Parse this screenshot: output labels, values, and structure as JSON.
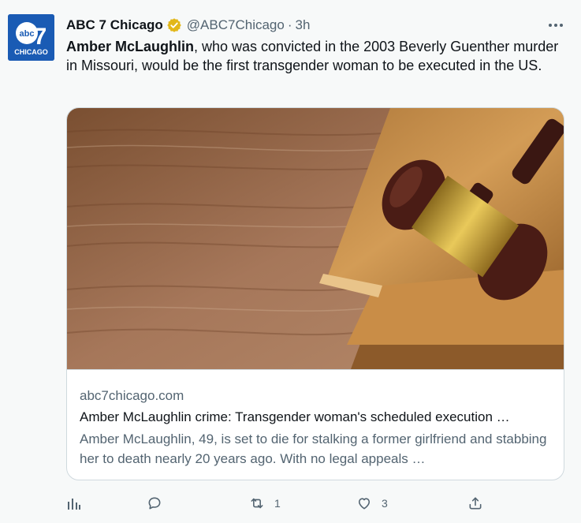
{
  "tweet": {
    "author_name": "ABC 7 Chicago",
    "author_handle": "@ABC7Chicago",
    "separator": "·",
    "time": "3h",
    "avatar_text_top": "abc",
    "avatar_text_7": "7",
    "avatar_text_bottom": "CHICAGO",
    "text_bold": "Amber McLaughlin",
    "text_rest": ", who was convicted in the 2003 Beverly Guenther murder in Missouri, would be the first transgender woman to be executed in the US."
  },
  "card": {
    "domain": "abc7chicago.com",
    "title": "Amber McLaughlin crime: Transgender woman's scheduled execution …",
    "description": "Amber McLaughlin, 49, is set to die for stalking a former girlfriend and stabbing her to death nearly 20 years ago. With no legal appeals …"
  },
  "actions": {
    "retweets": "1",
    "likes": "3"
  },
  "colors": {
    "brand_blue": "#1a5bb4",
    "verified_gold": "#e2b719",
    "muted_text": "#536471",
    "border": "#cfd9de"
  },
  "icons": {
    "verified": "verified-badge-icon",
    "more": "more-icon",
    "analytics": "analytics-icon",
    "reply": "reply-icon",
    "retweet": "retweet-icon",
    "like": "like-icon",
    "share": "share-icon"
  }
}
